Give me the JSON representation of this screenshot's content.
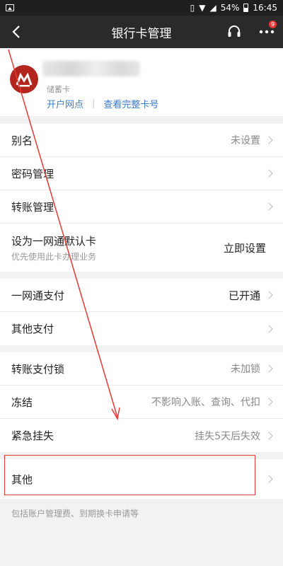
{
  "status": {
    "battery": "54%",
    "time": "16:45"
  },
  "nav": {
    "title": "银行卡管理",
    "badge": "9"
  },
  "card": {
    "type": "储蓄卡",
    "link_branch": "开户网点",
    "link_full_number": "查看完整卡号"
  },
  "group1": [
    {
      "label": "别名",
      "value": "未设置"
    },
    {
      "label": "密码管理",
      "value": ""
    },
    {
      "label": "转账管理",
      "value": ""
    }
  ],
  "default_card": {
    "label": "设为一网通默认卡",
    "sub": "优先使用此卡办理业务",
    "action": "立即设置"
  },
  "group2": [
    {
      "label": "一网通支付",
      "value": "已开通"
    },
    {
      "label": "其他支付",
      "value": ""
    }
  ],
  "group3": [
    {
      "label": "转账支付锁",
      "value": "未加锁"
    },
    {
      "label": "冻结",
      "value": "不影响入账、查询、代扣"
    },
    {
      "label": "紧急挂失",
      "value": "挂失5天后失效"
    }
  ],
  "group4": [
    {
      "label": "其他",
      "value": ""
    }
  ],
  "footer_note": "包括账户管理费、到期换卡申请等",
  "colors": {
    "accent_red": "#e53935",
    "link_blue": "#3b7bc8",
    "logo_red": "#b3261e"
  }
}
